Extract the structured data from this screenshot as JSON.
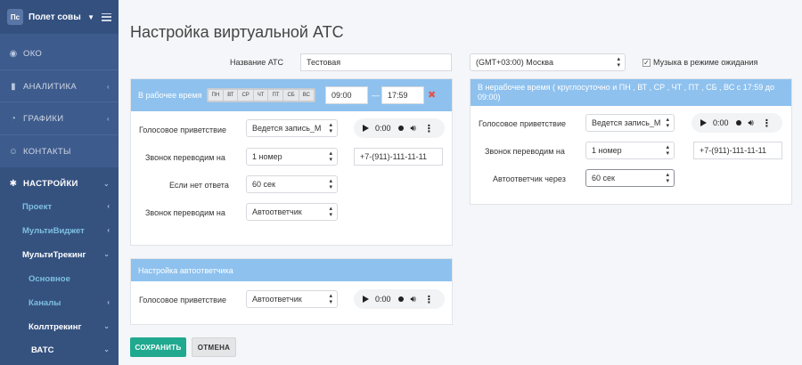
{
  "sidebar": {
    "avatar": "Пс",
    "user": "Полет совы",
    "items": [
      {
        "label": "ОКО",
        "icon": "eye-icon"
      },
      {
        "label": "АНАЛИТИКА",
        "icon": "bar-chart-icon"
      },
      {
        "label": "ГРАФИКИ",
        "icon": "pie-chart-icon"
      },
      {
        "label": "КОНТАКТЫ",
        "icon": "user-icon"
      },
      {
        "label": "НАСТРОЙКИ",
        "icon": "gear-icon"
      }
    ],
    "sub": {
      "project": "Проект",
      "multiwidget": "МультиВиджет",
      "multitracking": "МультиТрекинг",
      "basic": "Основное",
      "channels": "Каналы",
      "calltracking": "Коллтрекинг",
      "vats": "ВАТС"
    }
  },
  "page": {
    "title": "Настройка виртуальной АТС",
    "ats_name_label": "Название АТС",
    "ats_name_value": "Тестовая",
    "timezone": "(GMT+03:00) Москва",
    "hold_music_label": "Музыка в режиме ожидания"
  },
  "work_panel": {
    "title": "В рабочее время",
    "days": [
      "ПН",
      "ВТ",
      "СР",
      "ЧТ",
      "ПТ",
      "СБ",
      "ВС"
    ],
    "time_from": "09:00",
    "dash": "—",
    "time_to": "17:59",
    "greeting_label": "Голосовое приветствие",
    "greeting_value": "Ведется запись_М",
    "forward_label": "Звонок переводим на",
    "forward_value": "1 номер",
    "phone": "+7-(911)-111-11-11",
    "no_answer_label": "Если нет ответа",
    "no_answer_value": "60 сек",
    "forward2_label": "Звонок переводим на",
    "forward2_value": "Автоответчик"
  },
  "off_panel": {
    "title": "В нерабочее время ( круглосуточно и ПН , ВТ , СР , ЧТ , ПТ , СБ , ВС с 17:59 до 09:00)",
    "greeting_label": "Голосовое приветствие",
    "greeting_value": "Ведется запись_М",
    "forward_label": "Звонок переводим на",
    "forward_value": "1 номер",
    "phone": "+7-(911)-111-11-11",
    "answering_label": "Автоответчик через",
    "answering_value": "60 сек"
  },
  "autoresponder_panel": {
    "title": "Настройка автоответчика",
    "greeting_label": "Голосовое приветствие",
    "greeting_value": "Автоответчик"
  },
  "player": {
    "time": "0:00"
  },
  "buttons": {
    "save": "СОХРАНИТЬ",
    "cancel": "ОТМЕНА"
  }
}
